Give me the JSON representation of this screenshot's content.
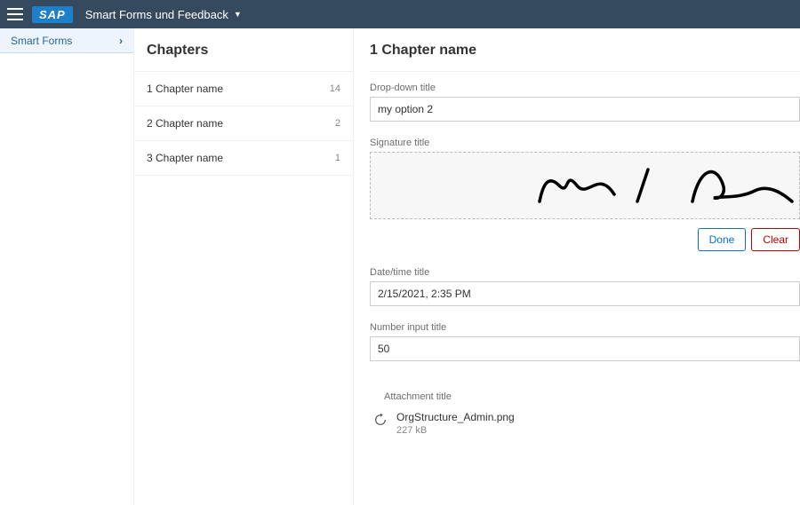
{
  "header": {
    "app_title": "Smart Forms und Feedback"
  },
  "breadcrumb": {
    "label": "Smart Forms"
  },
  "chapters": {
    "title": "Chapters",
    "items": [
      {
        "label": "1 Chapter name",
        "count": "14"
      },
      {
        "label": "2 Chapter name",
        "count": "2"
      },
      {
        "label": "3 Chapter name",
        "count": "1"
      }
    ]
  },
  "detail": {
    "title": "1 Chapter name",
    "dropdown": {
      "label": "Drop-down title",
      "value": "my option 2"
    },
    "signature": {
      "label": "Signature title",
      "done_label": "Done",
      "clear_label": "Clear"
    },
    "datetime": {
      "label": "Date/time title",
      "value": "2/15/2021, 2:35 PM"
    },
    "number": {
      "label": "Number input title",
      "value": "50"
    },
    "attachment": {
      "label": "Attachment title",
      "filename": "OrgStructure_Admin.png",
      "size": "227 kB"
    }
  }
}
